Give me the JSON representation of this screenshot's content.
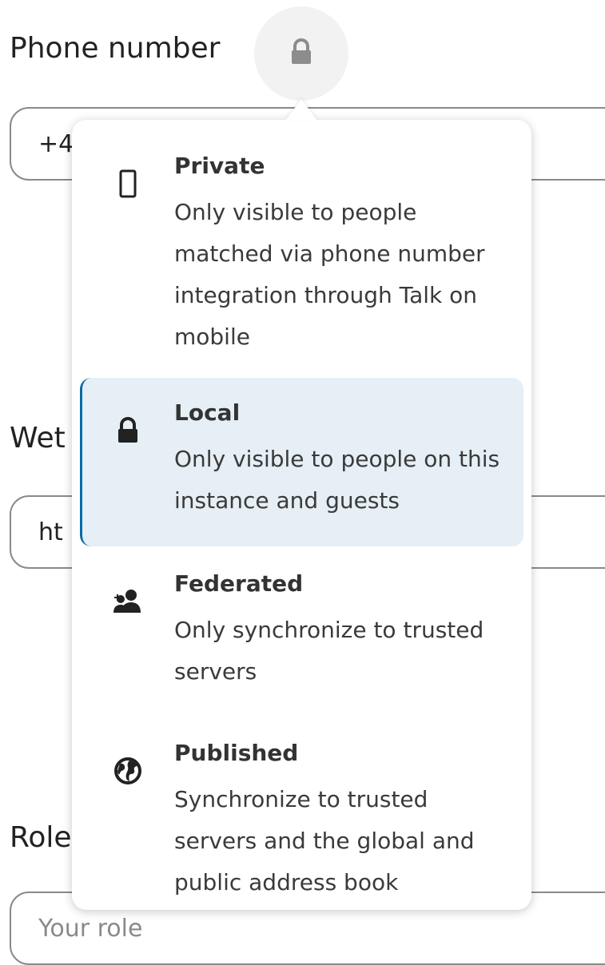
{
  "form": {
    "phone": {
      "label": "Phone number",
      "value": "+4"
    },
    "website": {
      "label": "Wet",
      "value": "ht"
    },
    "role": {
      "label": "Role",
      "placeholder": "Your role"
    },
    "scope_button_icon": "lock-icon"
  },
  "popover": {
    "options": [
      {
        "icon": "phone-icon",
        "title": "Private",
        "description": "Only visible to people matched via phone number integration through Talk on mobile",
        "active": false
      },
      {
        "icon": "lock-icon",
        "title": "Local",
        "description": "Only visible to people on this instance and guests",
        "active": true
      },
      {
        "icon": "contacts-icon",
        "title": "Federated",
        "description": "Only synchronize to trusted servers",
        "active": false
      },
      {
        "icon": "globe-icon",
        "title": "Published",
        "description": "Synchronize to trusted servers and the global and public address book",
        "active": false
      }
    ]
  },
  "colors": {
    "active_background": "#e5eff5",
    "active_border": "#0a6aa8",
    "field_border": "#8a8a8a"
  }
}
